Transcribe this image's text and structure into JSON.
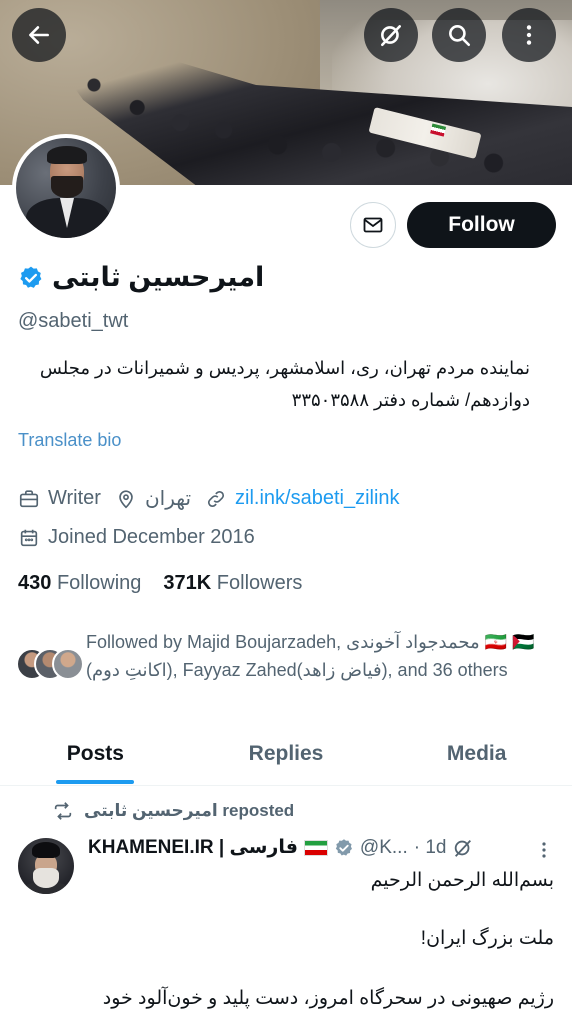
{
  "profile": {
    "display_name": "امیرحسین ثابتی",
    "handle": "@sabeti_twt",
    "bio": "نماینده مردم تهران، ری، اسلامشهر، پردیس و شمیرانات در مجلس دوازدهم/ شماره دفتر ۳۳۵۰۳۵۸۸",
    "translate_label": "Translate bio",
    "profession": "Writer",
    "location": "تهران",
    "website": "zil.ink/sabeti_zilink",
    "joined": "Joined December 2016",
    "following_count": "430",
    "following_label": "Following",
    "followers_count": "371K",
    "followers_label": "Followers",
    "follow_button": "Follow",
    "followed_by": "Followed by Majid Boujarzadeh, محمدجواد آخوندی 🇮🇷 🇵🇸(اکانتِ دوم), Fayyaz Zahed(فیاض زاهد), and 36 others"
  },
  "tabs": [
    {
      "label": "Posts",
      "active": true
    },
    {
      "label": "Replies",
      "active": false
    },
    {
      "label": "Media",
      "active": false
    }
  ],
  "post": {
    "repost_label": "امیرحسین ثابتی reposted",
    "author": "KHAMENEI.IR | فارسی",
    "handle": "@K...",
    "time": "· 1d",
    "line1": "بسم‌الله الرحمن الرحیم",
    "line2": "ملت بزرگ ایران!",
    "line3": "رژیم صهیونی در سحرگاه امروز، دست پلید و خون‌آلود خود"
  },
  "colors": {
    "accent": "#1d9bf0",
    "text_primary": "#0f1419",
    "text_secondary": "#536471",
    "follow_bg": "#0f1419"
  },
  "icons": {
    "back": "arrow-left-icon",
    "grok": "grok-icon",
    "search": "search-icon",
    "more": "more-vertical-icon",
    "message": "envelope-icon",
    "verified": "verified-badge-icon",
    "briefcase": "briefcase-icon",
    "location": "location-pin-icon",
    "link": "link-icon",
    "calendar": "calendar-icon",
    "repost": "repost-icon"
  }
}
